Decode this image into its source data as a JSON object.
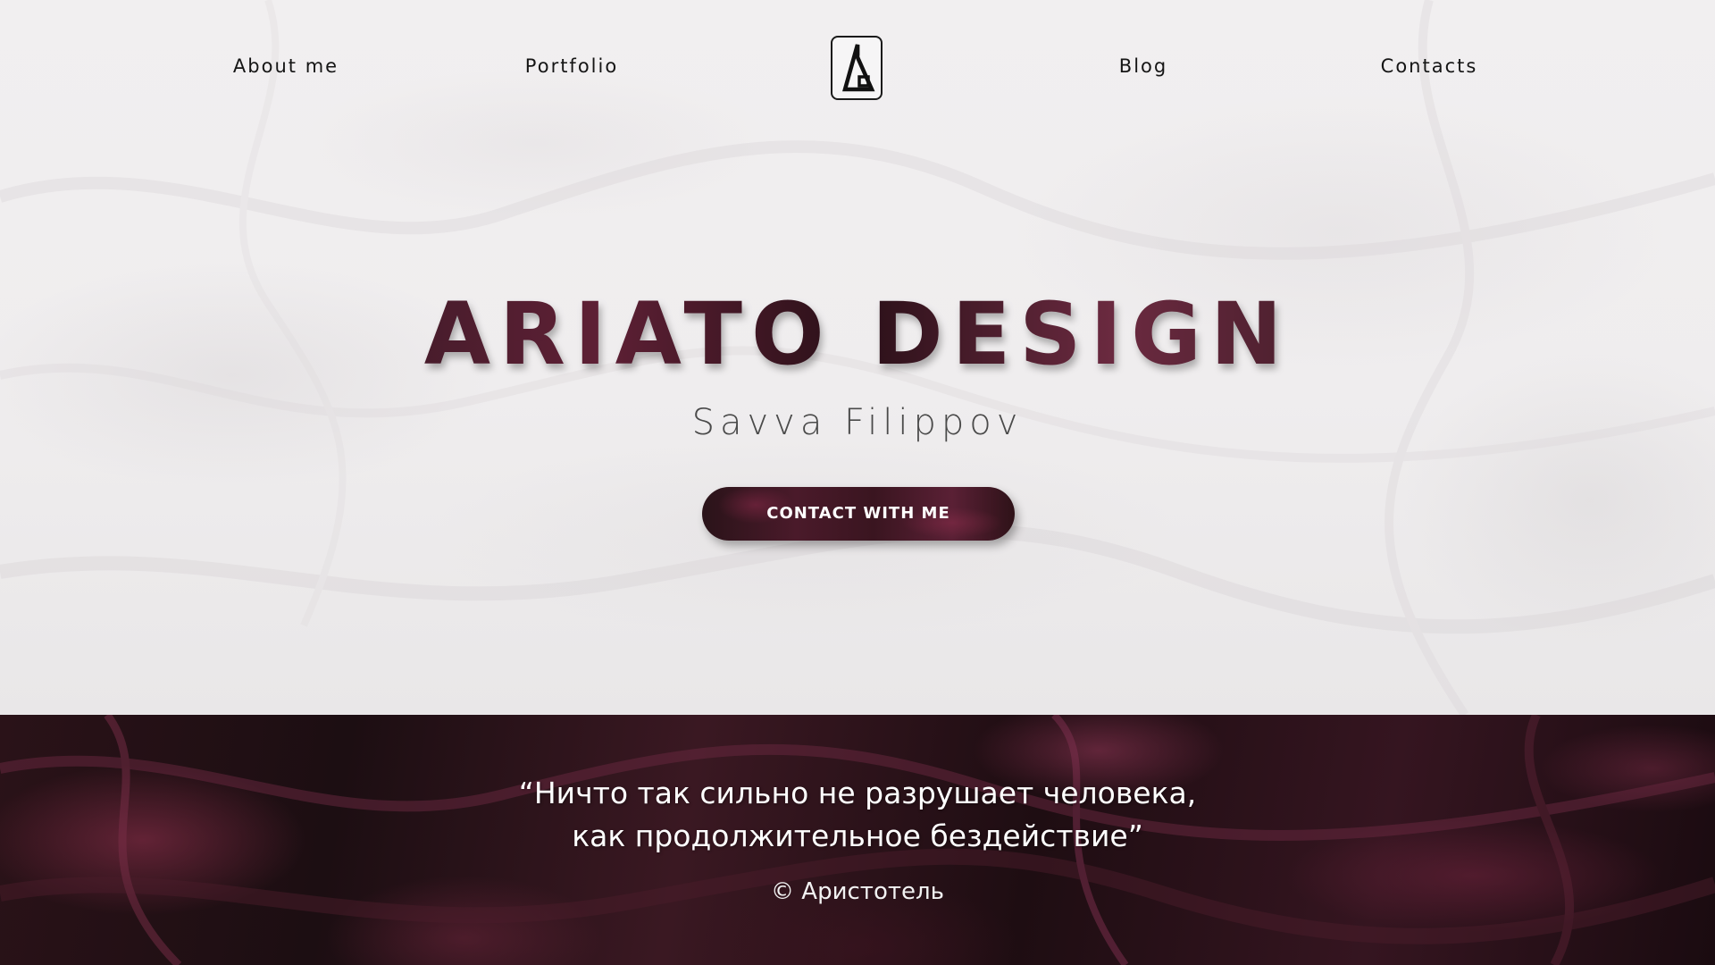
{
  "nav": {
    "left": [
      {
        "label": "About me"
      },
      {
        "label": "Portfolio"
      }
    ],
    "right": [
      {
        "label": "Blog"
      },
      {
        "label": "Contacts"
      }
    ],
    "logo_icon": "ariato-logo-icon"
  },
  "hero": {
    "title": "ARIATO DESIGN",
    "subtitle": "Savva Filippov",
    "cta_label": "CONTACT WITH ME"
  },
  "quote": {
    "line1": "“Ничто так сильно не разрушает человека,",
    "line2": "как продолжительное бездействие”",
    "author": "© Аристотель"
  },
  "colors": {
    "accent": "#5e2035",
    "dark_marble": "#1c0e12",
    "light_marble": "#efedee",
    "text_dark": "#151515"
  }
}
